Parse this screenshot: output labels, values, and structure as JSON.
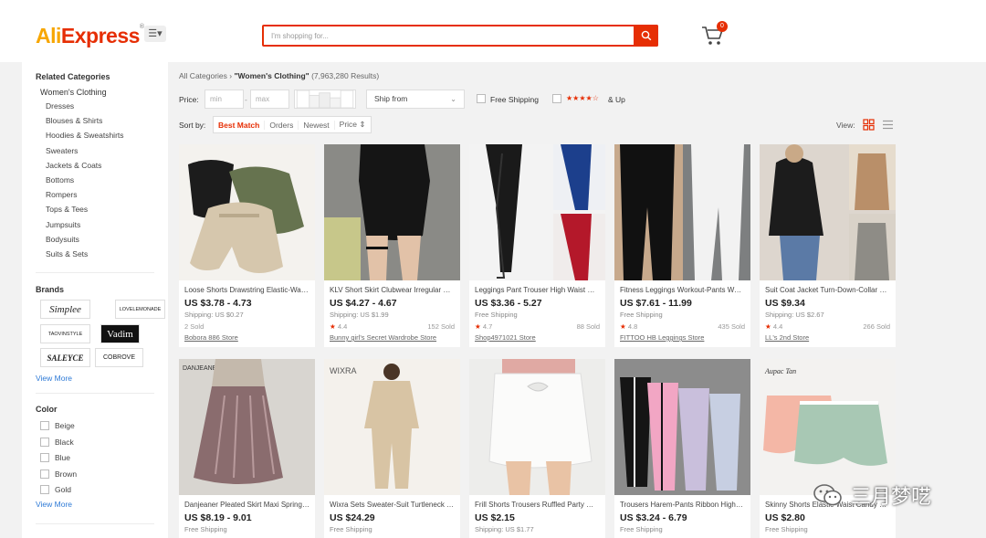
{
  "header": {
    "logo_part1": "Ali",
    "logo_part2": "Express",
    "logo_mark": "®",
    "menu_icon": "menu-list-icon",
    "search_placeholder": "I'm shopping for...",
    "cart_count": "0"
  },
  "sidebar": {
    "related_title": "Related Categories",
    "main_category": "Women's Clothing",
    "categories": [
      "Dresses",
      "Blouses & Shirts",
      "Hoodies & Sweatshirts",
      "Sweaters",
      "Jackets & Coats",
      "Bottoms",
      "Rompers",
      "Tops & Tees",
      "Jumpsuits",
      "Bodysuits",
      "Suits & Sets"
    ],
    "brands_title": "Brands",
    "brands": [
      "Simplee",
      "LOVELEMONADE",
      "TAOVINSTYLE",
      "Vadim",
      "SALEYCE",
      "COBROVE"
    ],
    "view_more": "View More",
    "color_title": "Color",
    "colors": [
      "Beige",
      "Black",
      "Blue",
      "Brown",
      "Gold"
    ]
  },
  "toolbar": {
    "breadcrumb_root": "All Categories",
    "breadcrumb_sep": "›",
    "breadcrumb_current": "\"Women's Clothing\"",
    "results": "(7,963,280 Results)",
    "price_label": "Price:",
    "price_min_ph": "min",
    "price_dash": "-",
    "price_max_ph": "max",
    "ship_from": "Ship from",
    "free_shipping": "Free Shipping",
    "rating_stars": "★★★★☆",
    "rating_suffix": "& Up",
    "sort_label": "Sort by:",
    "sort_options": [
      "Best Match",
      "Orders",
      "Newest",
      "Price ⇕"
    ],
    "view_label": "View:"
  },
  "products": [
    {
      "title": "Loose Shorts Drawstring Elastic-Waist Wide-Leg Women",
      "price": "US $3.78 - 4.73",
      "shipping": "Shipping: US $0.27",
      "rating": "",
      "sold": "2 Sold",
      "store": "Bobora 886 Store"
    },
    {
      "title": "KLV Short Skirt Clubwear Irregular Women",
      "price": "US $4.27 - 4.67",
      "shipping": "Shipping: US $1.99",
      "rating": "4.4",
      "sold": "152 Sold",
      "store": "Bunny girl's Secret Wardrobe Store"
    },
    {
      "title": "Leggings Pant Trouser High Waist Women",
      "price": "US $3.36 - 5.27",
      "shipping": "Free Shipping",
      "rating": "4.7",
      "sold": "88 Sold",
      "store": "Shop4971021 Store"
    },
    {
      "title": "Fitness Leggings Workout-Pants Women",
      "price": "US $7.61 - 11.99",
      "shipping": "Free Shipping",
      "rating": "4.8",
      "sold": "435 Sold",
      "store": "FITTOO HB Leggings Store"
    },
    {
      "title": "Suit Coat Jacket Turn-Down-Collar Women",
      "price": "US $9.34",
      "shipping": "Shipping: US $2.67",
      "rating": "4.4",
      "sold": "266 Sold",
      "store": "LL's 2nd Store"
    },
    {
      "title": "Danjeaner Pleated Skirt Maxi Spring Women",
      "price": "US $8.19 - 9.01",
      "shipping": "Free Shipping",
      "rating": "",
      "sold": "",
      "store": ""
    },
    {
      "title": "Wixra Sets Sweater-Suit Turtleneck Women",
      "price": "US $24.29",
      "shipping": "Free Shipping",
      "rating": "",
      "sold": "",
      "store": ""
    },
    {
      "title": "Frill Shorts Trousers Ruffled Party Women",
      "price": "US $2.15",
      "shipping": "Shipping: US $1.77",
      "rating": "",
      "sold": "",
      "store": ""
    },
    {
      "title": "Trousers Harem-Pants Ribbon High Waist",
      "price": "US $3.24 - 6.79",
      "shipping": "Free Shipping",
      "rating": "",
      "sold": "",
      "store": ""
    },
    {
      "title": "Skinny Shorts Elastic-Waist Candy Color",
      "price": "US $2.80",
      "shipping": "Free Shipping",
      "rating": "",
      "sold": "",
      "store": ""
    }
  ],
  "product_image_labels": {
    "p5": "DANJEANER",
    "p6": "WIXRA",
    "p9": "Aupac Tan"
  },
  "watermark": "三月梦呓",
  "colors": {
    "accent": "#e62e04",
    "logo_orange": "#f7a600",
    "link": "#2e7ad6"
  }
}
